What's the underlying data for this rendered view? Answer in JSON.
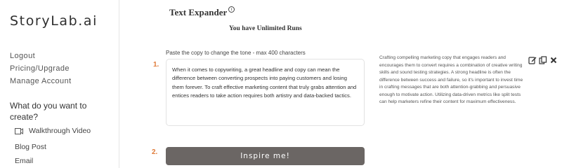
{
  "app": {
    "logo": "StoryLab.ai"
  },
  "nav": {
    "logout": "Logout",
    "pricing": "Pricing/Upgrade",
    "account": "Manage Account"
  },
  "sidebar": {
    "section_question": "What do you want to create?",
    "items": [
      {
        "label": "Walkthrough Video",
        "icon": "video-icon"
      },
      {
        "label": "Blog Post"
      },
      {
        "label": "Email"
      }
    ]
  },
  "main": {
    "title": "Text Expander",
    "title_info_icon": "i",
    "runs_status": "You have Unlimited Runs",
    "step1": {
      "number": "1.",
      "label": "Paste the copy to change the tone - max 400 characters",
      "value": "When it comes to copywriting, a great headline and copy can mean the difference between converting prospects into paying customers and losing them forever. To craft effective marketing content that truly grabs attention and entices readers to take action requires both artistry and data-backed tactics."
    },
    "step2": {
      "number": "2.",
      "button_label": "Inspire me!"
    },
    "output": {
      "text": "Crafting compelling marketing copy that engages readers and encourages them to convert requires a combination of creative writing skills and sound testing strategies. A strong headline is often the difference between success and failure, so it's important to invest time in crafting messages that are both attention-grabbing and persuasive enough to motivate action. Utilizing data-driven metrics like split tests can help marketers refine their content for maximum effectiveness.",
      "actions": [
        "edit-icon",
        "copy-icon",
        "close-icon"
      ]
    }
  },
  "colors": {
    "step_number": "#e07b39",
    "button_bg": "#6b6664",
    "button_text": "#ffffff"
  }
}
